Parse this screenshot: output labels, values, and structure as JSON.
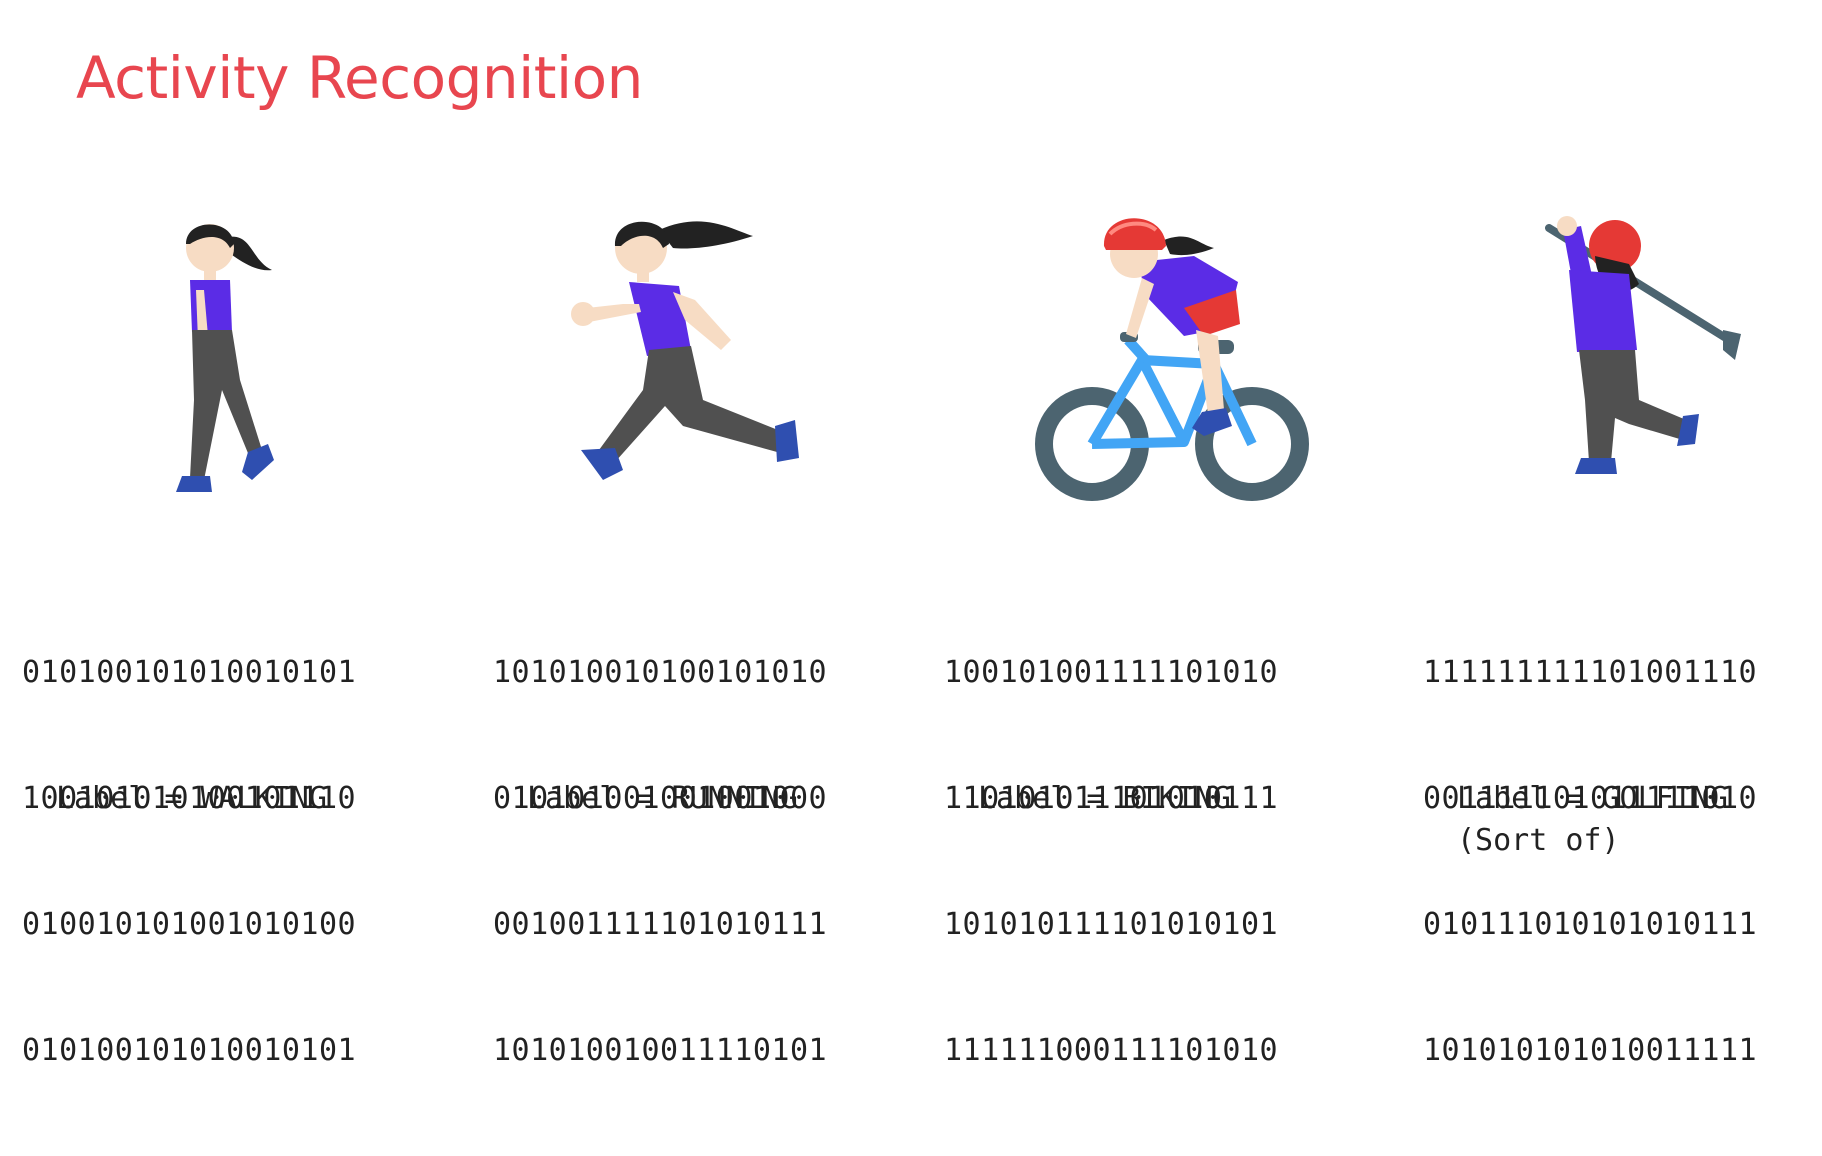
{
  "title": "Activity Recognition",
  "activities": [
    {
      "bits": [
        "010100101010010101",
        "100101010100101110",
        "010010101001010100",
        "010100101010010101"
      ],
      "label": "Label = WALKING",
      "note": "",
      "icon": "walking-woman-icon"
    },
    {
      "bits": [
        "101010010100101010",
        "010101001001001000",
        "001001111101010111",
        "101010010011110101"
      ],
      "label": "Label = RUNNING",
      "note": "",
      "icon": "running-woman-icon"
    },
    {
      "bits": [
        "100101001111101010",
        "110101011101010111",
        "101010111101010101",
        "111111000111101010"
      ],
      "label": "Label = BIKING",
      "note": "",
      "icon": "biking-woman-icon"
    },
    {
      "bits": [
        "111111111101001110",
        "001111101011111010",
        "010111010101010111",
        "101010101010011111"
      ],
      "label": "Label = GOLFING",
      "note": "(Sort of)",
      "icon": "golfing-woman-icon"
    }
  ],
  "colors": {
    "title": "#e8464f",
    "shirt": "#5b2ce6",
    "pants": "#505050",
    "shoe": "#2f4fb0",
    "skin": "#f7dcc4",
    "hair": "#222222",
    "helmet": "#e53935",
    "bike_frame": "#42a5f5",
    "wheel": "#4c6470"
  }
}
